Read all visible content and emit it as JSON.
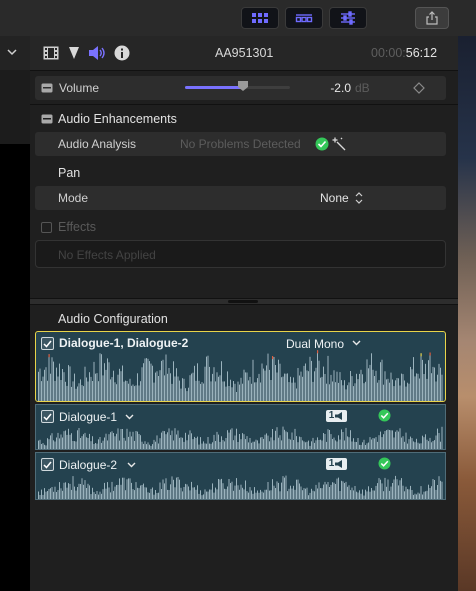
{
  "inspector": {
    "clip_name": "AA951301",
    "timecode_dim": "00:00:",
    "timecode_main": "56:12"
  },
  "volume": {
    "label": "Volume",
    "value": "-2.0",
    "unit": "dB",
    "level": 0.55
  },
  "enhancements": {
    "title": "Audio Enhancements",
    "analysis_label": "Audio Analysis",
    "analysis_status": "No Problems Detected"
  },
  "pan": {
    "title": "Pan",
    "mode_label": "Mode",
    "mode_value": "None"
  },
  "effects": {
    "title": "Effects",
    "placeholder": "No Effects Applied"
  },
  "audio_config": {
    "title": "Audio Configuration",
    "main_clip": {
      "name": "Dialogue-1, Dialogue-2",
      "mode": "Dual Mono"
    },
    "channels": [
      {
        "name": "Dialogue-1",
        "badge": "1"
      },
      {
        "name": "Dialogue-2",
        "badge": "1"
      }
    ]
  },
  "colors": {
    "accent_purple": "#7a72ff",
    "check_green": "#34c759",
    "clip_bg": "#24424f",
    "selected_outline": "#e8d44a",
    "waveform": "#9bb3bd"
  }
}
